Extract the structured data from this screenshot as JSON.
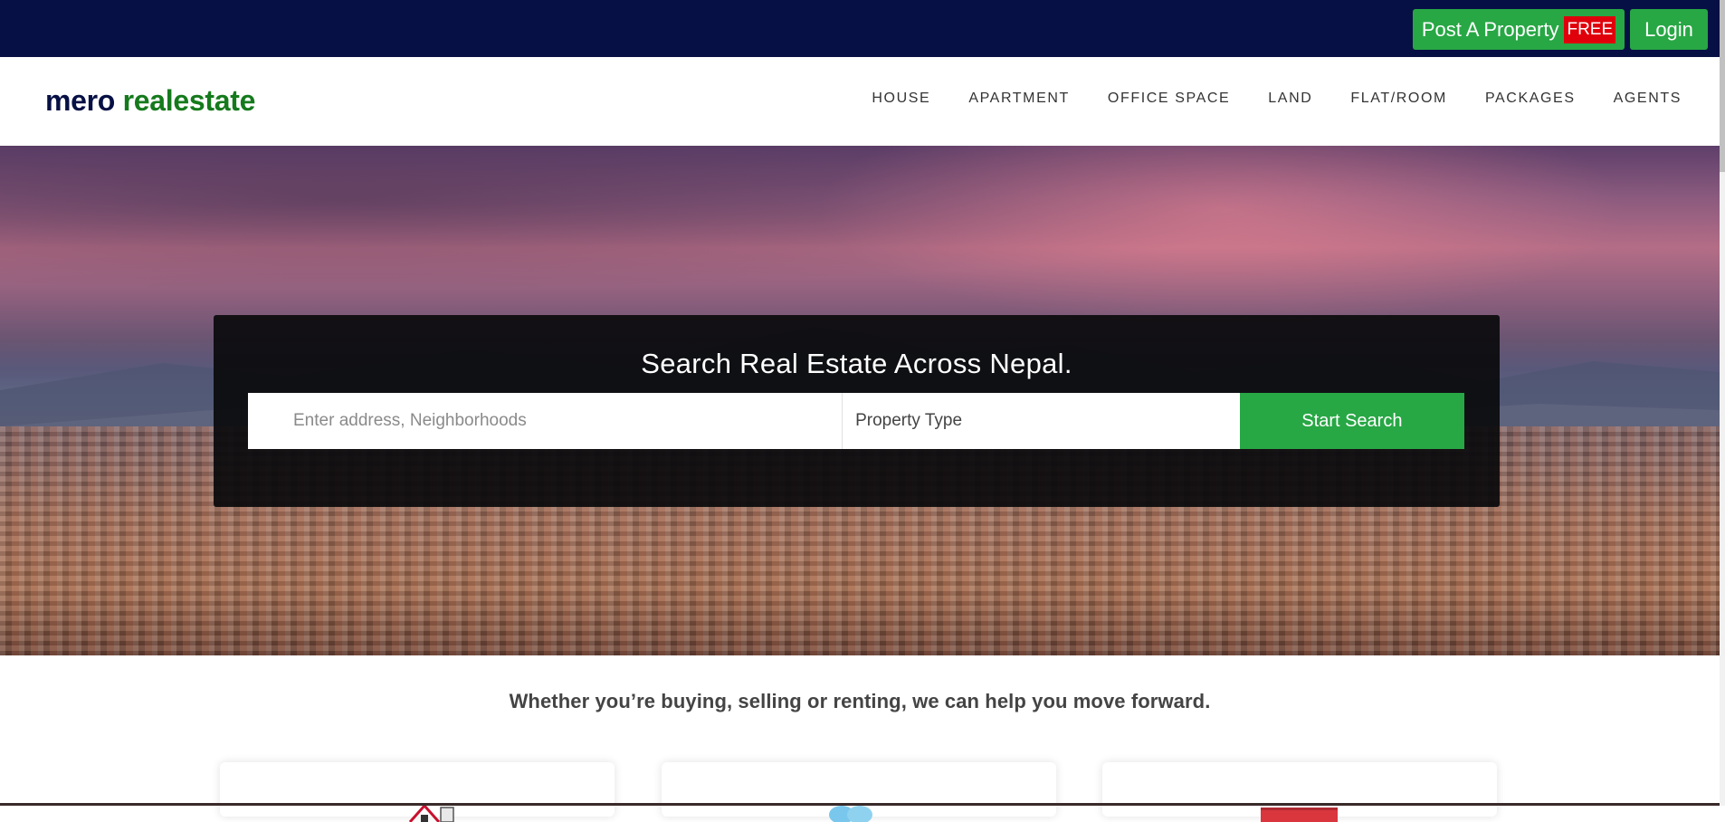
{
  "topbar": {
    "post_label": "Post A Property",
    "free_badge": "FREE",
    "login_label": "Login"
  },
  "header": {
    "logo_part1": "mero",
    "logo_part2": "realestate",
    "nav": [
      "HOUSE",
      "APARTMENT",
      "OFFICE SPACE",
      "LAND",
      "FLAT/ROOM",
      "PACKAGES",
      "AGENTS"
    ]
  },
  "hero": {
    "title": "Search Real Estate Across Nepal.",
    "address_placeholder": "Enter address, Neighborhoods",
    "address_value": "",
    "property_type": "Property Type",
    "search_button": "Start Search"
  },
  "tagline": "Whether you’re buying, selling or renting, we can help you move forward.",
  "cards": [
    {
      "icon": "house-icon"
    },
    {
      "icon": "handshake-icon"
    },
    {
      "icon": "sign-icon"
    }
  ],
  "colors": {
    "topbar_bg": "#071044",
    "green": "#28a745",
    "free_red": "#e0000b",
    "logo_navy": "#071044",
    "logo_green": "#157a1c"
  }
}
